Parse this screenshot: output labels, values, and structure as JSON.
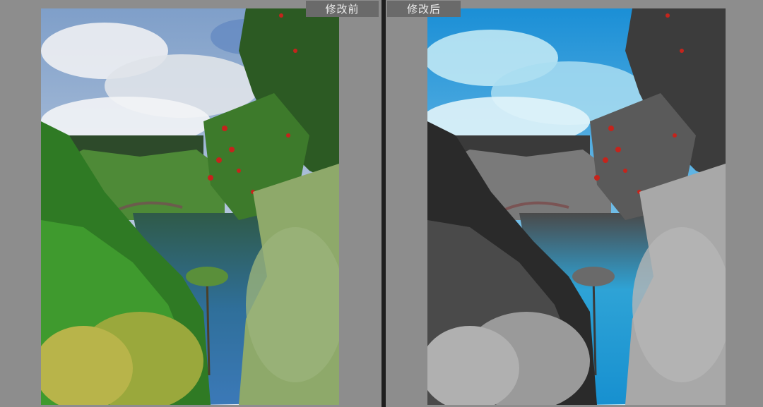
{
  "labels": {
    "before": "修改前",
    "after": "修改后"
  },
  "photos": {
    "before": {
      "description_icon": "landscape-photo-icon",
      "style": "full-color"
    },
    "after": {
      "description_icon": "landscape-photo-icon",
      "style": "selective-color"
    }
  },
  "colors": {
    "background": "#8d8d8d",
    "divider": "#1e1e1e",
    "label_bg": "#6a6a6a",
    "label_text": "#ececec"
  }
}
